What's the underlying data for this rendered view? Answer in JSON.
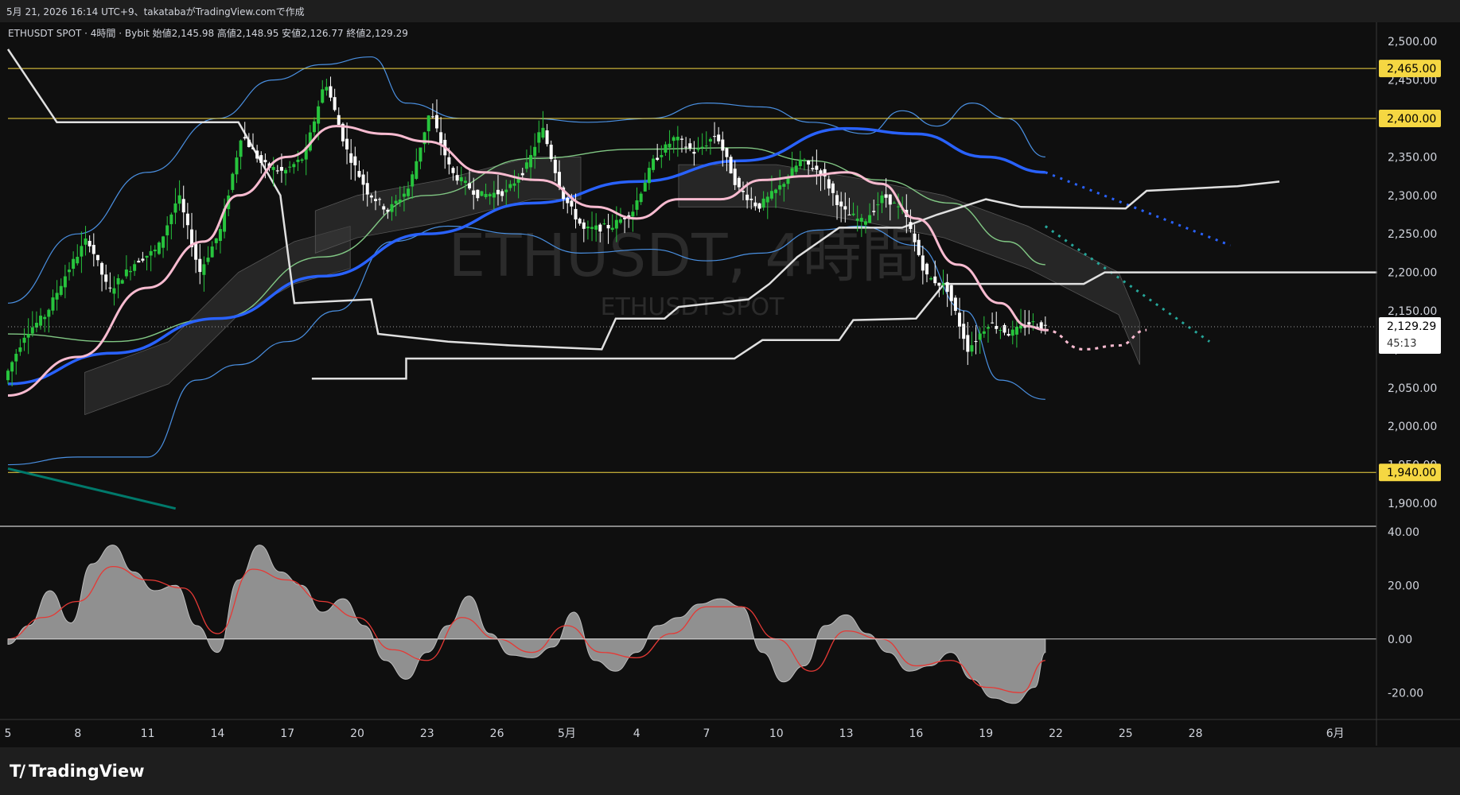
{
  "header": {
    "timestamp_line": "5月 21, 2026 16:14 UTC+9、takatabaがTradingView.comで作成"
  },
  "legend": {
    "text": "ETHUSDT SPOT · 4時間 · Bybit  始値2,145.98 高値2,148.95 安値2,126.77 終値2,129.29"
  },
  "watermark": {
    "main": "ETHUSDT, 4時間",
    "sub": "ETHUSDT SPOT"
  },
  "footer": {
    "brand": "TradingView"
  },
  "colors": {
    "background": "#0f0f0f",
    "candle_up": "#27c43d",
    "candle_down": "#ffffff",
    "pink_ma": "#f8bbd0",
    "blue_ma": "#2962ff",
    "green_ma": "#81c784",
    "bollinger": "#4a90e2",
    "horizontal_level": "#f5d742",
    "oscillator_fill": "#9e9e9e",
    "signal": "#e53935"
  },
  "chart_data": {
    "type": "candlestick",
    "symbol": "ETHUSDT SPOT",
    "interval": "4時間",
    "exchange": "Bybit",
    "ohlc_last": {
      "open": 2145.98,
      "high": 2148.95,
      "low": 2126.77,
      "close": 2129.29
    },
    "last_price": "2,129.29",
    "countdown": "45:13",
    "price_axis": {
      "ylim": [
        1870,
        2525
      ],
      "ticks": [
        1900,
        1950,
        2000,
        2050,
        2100,
        2150,
        2200,
        2250,
        2300,
        2350,
        2400,
        2450,
        2500
      ],
      "tick_labels": [
        "1,900.00",
        "1,950.00",
        "2,000.00",
        "2,050.00",
        "2,100.00",
        "2,150.00",
        "2,200.00",
        "2,250.00",
        "2,300.00",
        "2,350.00",
        "2,400.00",
        "2,450.00",
        "2,500.00"
      ]
    },
    "horizontal_levels": [
      {
        "value": 2465,
        "label": "2,465.00"
      },
      {
        "value": 2400,
        "label": "2,400.00"
      },
      {
        "value": 1940,
        "label": "1,940.00"
      }
    ],
    "x_axis": {
      "ticks": [
        {
          "label": "5",
          "x": 0
        },
        {
          "label": "8",
          "x": 1
        },
        {
          "label": "11",
          "x": 2
        },
        {
          "label": "14",
          "x": 3
        },
        {
          "label": "17",
          "x": 4
        },
        {
          "label": "20",
          "x": 5
        },
        {
          "label": "23",
          "x": 6
        },
        {
          "label": "26",
          "x": 7
        },
        {
          "label": "5月",
          "x": 8
        },
        {
          "label": "4",
          "x": 9
        },
        {
          "label": "7",
          "x": 10
        },
        {
          "label": "10",
          "x": 11
        },
        {
          "label": "13",
          "x": 12
        },
        {
          "label": "16",
          "x": 13
        },
        {
          "label": "19",
          "x": 14
        },
        {
          "label": "22",
          "x": 15
        },
        {
          "label": "25",
          "x": 16
        },
        {
          "label": "28",
          "x": 17
        },
        {
          "label": "6月",
          "x": 19
        }
      ]
    },
    "price_path": [
      [
        0,
        2060
      ],
      [
        0.3,
        2120
      ],
      [
        0.6,
        2145
      ],
      [
        0.9,
        2200
      ],
      [
        1.2,
        2245
      ],
      [
        1.5,
        2175
      ],
      [
        1.9,
        2215
      ],
      [
        2.2,
        2230
      ],
      [
        2.5,
        2300
      ],
      [
        2.8,
        2200
      ],
      [
        3.1,
        2255
      ],
      [
        3.4,
        2380
      ],
      [
        3.7,
        2340
      ],
      [
        4.0,
        2330
      ],
      [
        4.3,
        2350
      ],
      [
        4.6,
        2450
      ],
      [
        4.9,
        2360
      ],
      [
        5.2,
        2305
      ],
      [
        5.5,
        2280
      ],
      [
        5.8,
        2310
      ],
      [
        6.1,
        2410
      ],
      [
        6.4,
        2330
      ],
      [
        6.8,
        2300
      ],
      [
        7.2,
        2305
      ],
      [
        7.5,
        2340
      ],
      [
        7.7,
        2390
      ],
      [
        8.0,
        2300
      ],
      [
        8.3,
        2255
      ],
      [
        8.7,
        2260
      ],
      [
        9.0,
        2280
      ],
      [
        9.3,
        2345
      ],
      [
        9.6,
        2375
      ],
      [
        9.9,
        2355
      ],
      [
        10.2,
        2380
      ],
      [
        10.5,
        2310
      ],
      [
        10.8,
        2285
      ],
      [
        11.1,
        2310
      ],
      [
        11.4,
        2345
      ],
      [
        11.7,
        2330
      ],
      [
        12.0,
        2280
      ],
      [
        12.3,
        2265
      ],
      [
        12.6,
        2300
      ],
      [
        12.9,
        2275
      ],
      [
        13.2,
        2195
      ],
      [
        13.5,
        2180
      ],
      [
        13.8,
        2100
      ],
      [
        14.1,
        2135
      ],
      [
        14.4,
        2120
      ],
      [
        14.7,
        2135
      ],
      [
        14.85,
        2129
      ]
    ],
    "pink_ma": [
      [
        0,
        2040
      ],
      [
        1,
        2090
      ],
      [
        2,
        2180
      ],
      [
        2.8,
        2240
      ],
      [
        3.3,
        2300
      ],
      [
        4,
        2350
      ],
      [
        4.7,
        2390
      ],
      [
        5.4,
        2380
      ],
      [
        6,
        2370
      ],
      [
        6.8,
        2330
      ],
      [
        7.6,
        2320
      ],
      [
        8.4,
        2285
      ],
      [
        9,
        2270
      ],
      [
        9.6,
        2295
      ],
      [
        10.2,
        2295
      ],
      [
        10.8,
        2320
      ],
      [
        11.4,
        2325
      ],
      [
        12,
        2330
      ],
      [
        12.5,
        2315
      ],
      [
        13,
        2270
      ],
      [
        13.6,
        2210
      ],
      [
        14.2,
        2160
      ],
      [
        14.6,
        2130
      ],
      [
        14.85,
        2125
      ]
    ],
    "blue_ma": [
      [
        0,
        2055
      ],
      [
        1.5,
        2095
      ],
      [
        3,
        2140
      ],
      [
        4.5,
        2195
      ],
      [
        6,
        2250
      ],
      [
        7.5,
        2290
      ],
      [
        9,
        2318
      ],
      [
        10.5,
        2345
      ],
      [
        12,
        2387
      ],
      [
        13.0,
        2380
      ],
      [
        14.0,
        2350
      ],
      [
        14.85,
        2330
      ]
    ],
    "blue_ma_projection": [
      [
        14.85,
        2330
      ],
      [
        17.5,
        2235
      ]
    ],
    "green_ma": [
      [
        0,
        2120
      ],
      [
        1.5,
        2110
      ],
      [
        3,
        2140
      ],
      [
        4.5,
        2220
      ],
      [
        6,
        2300
      ],
      [
        7.5,
        2348
      ],
      [
        9,
        2360
      ],
      [
        10.5,
        2362
      ],
      [
        11.5,
        2345
      ],
      [
        12.5,
        2320
      ],
      [
        13.5,
        2290
      ],
      [
        14.3,
        2240
      ],
      [
        14.85,
        2210
      ]
    ],
    "green_projection": [
      [
        14.85,
        2260
      ],
      [
        17.2,
        2110
      ]
    ],
    "bollinger_upper": [
      [
        0,
        2160
      ],
      [
        1,
        2250
      ],
      [
        2,
        2330
      ],
      [
        3,
        2400
      ],
      [
        3.8,
        2450
      ],
      [
        4.5,
        2470
      ],
      [
        5.2,
        2480
      ],
      [
        5.7,
        2420
      ],
      [
        6.5,
        2400
      ],
      [
        7.5,
        2400
      ],
      [
        8.3,
        2395
      ],
      [
        9.2,
        2400
      ],
      [
        10,
        2420
      ],
      [
        10.8,
        2415
      ],
      [
        11.5,
        2395
      ],
      [
        12.3,
        2380
      ],
      [
        12.8,
        2410
      ],
      [
        13.3,
        2390
      ],
      [
        13.8,
        2420
      ],
      [
        14.3,
        2400
      ],
      [
        14.85,
        2350
      ]
    ],
    "bollinger_lower": [
      [
        0,
        1950
      ],
      [
        1,
        1960
      ],
      [
        2,
        1960
      ],
      [
        2.7,
        2060
      ],
      [
        3.3,
        2080
      ],
      [
        4,
        2110
      ],
      [
        4.7,
        2150
      ],
      [
        5.5,
        2240
      ],
      [
        6.3,
        2260
      ],
      [
        7.3,
        2250
      ],
      [
        8.2,
        2225
      ],
      [
        9.2,
        2230
      ],
      [
        10,
        2215
      ],
      [
        10.8,
        2225
      ],
      [
        11.6,
        2255
      ],
      [
        12.2,
        2260
      ],
      [
        13,
        2235
      ],
      [
        13.7,
        2150
      ],
      [
        14.2,
        2060
      ],
      [
        14.85,
        2035
      ]
    ],
    "white_step_line": [
      [
        0,
        2490
      ],
      [
        0.7,
        2395
      ],
      [
        3.3,
        2395
      ],
      [
        3.9,
        2300
      ],
      [
        4.1,
        2160
      ],
      [
        5.2,
        2165
      ],
      [
        5.3,
        2120
      ],
      [
        6.3,
        2110
      ],
      [
        7.2,
        2105
      ],
      [
        8.5,
        2100
      ],
      [
        8.7,
        2140
      ],
      [
        9.4,
        2140
      ],
      [
        9.6,
        2155
      ],
      [
        10.6,
        2165
      ],
      [
        10.9,
        2185
      ],
      [
        11.3,
        2220
      ],
      [
        11.9,
        2258
      ],
      [
        12.8,
        2258
      ],
      [
        13.3,
        2275
      ],
      [
        14.0,
        2295
      ],
      [
        14.5,
        2285
      ],
      [
        16.0,
        2283
      ],
      [
        16.3,
        2306
      ],
      [
        17.6,
        2312
      ],
      [
        18.2,
        2318
      ]
    ],
    "white_lower_line": [
      [
        4.7,
        2062
      ],
      [
        5.7,
        2062
      ],
      [
        5.7,
        2088
      ],
      [
        10.4,
        2088
      ],
      [
        10.8,
        2112
      ],
      [
        11.9,
        2112
      ],
      [
        12.1,
        2138
      ],
      [
        13.0,
        2140
      ],
      [
        13.4,
        2185
      ],
      [
        15.4,
        2185
      ],
      [
        15.7,
        2200
      ],
      [
        19.6,
        2200
      ]
    ],
    "white_lower_line_start": 4.35,
    "projection_dotted": [
      [
        14.85,
        2125
      ],
      [
        15.4,
        2100
      ],
      [
        15.9,
        2105
      ],
      [
        16.3,
        2125
      ]
    ],
    "cloud_segments": [
      [
        [
          1.1,
          2070
        ],
        [
          2.3,
          2110
        ],
        [
          3.3,
          2200
        ],
        [
          4.1,
          2240
        ],
        [
          4.9,
          2260
        ]
      ],
      [
        [
          4.4,
          2280
        ],
        [
          5.0,
          2300
        ],
        [
          6.2,
          2320
        ],
        [
          7.5,
          2350
        ],
        [
          8.2,
          2350
        ]
      ],
      [
        [
          9.6,
          2340
        ],
        [
          11.0,
          2340
        ],
        [
          12.3,
          2320
        ],
        [
          13.4,
          2300
        ],
        [
          14.6,
          2260
        ],
        [
          15.9,
          2200
        ],
        [
          16.2,
          2135
        ]
      ]
    ],
    "trend_line_green": [
      [
        0,
        1945
      ],
      [
        2.4,
        1893
      ]
    ],
    "oscillator": {
      "ylim": [
        -30,
        42
      ],
      "ticks": [
        40,
        20,
        0,
        -20
      ],
      "tick_labels": [
        "40.00",
        "20.00",
        "0.00",
        "-20.00"
      ],
      "values": [
        [
          0,
          -2
        ],
        [
          0.3,
          5
        ],
        [
          0.6,
          18
        ],
        [
          0.9,
          6
        ],
        [
          1.2,
          28
        ],
        [
          1.5,
          35
        ],
        [
          1.8,
          25
        ],
        [
          2.1,
          18
        ],
        [
          2.4,
          20
        ],
        [
          2.7,
          5
        ],
        [
          3.0,
          -5
        ],
        [
          3.3,
          22
        ],
        [
          3.6,
          35
        ],
        [
          3.9,
          25
        ],
        [
          4.2,
          20
        ],
        [
          4.5,
          10
        ],
        [
          4.8,
          15
        ],
        [
          5.1,
          5
        ],
        [
          5.4,
          -8
        ],
        [
          5.7,
          -15
        ],
        [
          6.0,
          -5
        ],
        [
          6.3,
          5
        ],
        [
          6.6,
          16
        ],
        [
          6.9,
          2
        ],
        [
          7.2,
          -6
        ],
        [
          7.5,
          -7
        ],
        [
          7.8,
          -3
        ],
        [
          8.1,
          10
        ],
        [
          8.4,
          -8
        ],
        [
          8.7,
          -12
        ],
        [
          9.0,
          -5
        ],
        [
          9.3,
          5
        ],
        [
          9.6,
          8
        ],
        [
          9.9,
          13
        ],
        [
          10.2,
          15
        ],
        [
          10.5,
          12
        ],
        [
          10.8,
          -5
        ],
        [
          11.1,
          -16
        ],
        [
          11.4,
          -10
        ],
        [
          11.7,
          5
        ],
        [
          12.0,
          9
        ],
        [
          12.3,
          2
        ],
        [
          12.6,
          -5
        ],
        [
          12.9,
          -12
        ],
        [
          13.2,
          -10
        ],
        [
          13.5,
          -5
        ],
        [
          13.8,
          -15
        ],
        [
          14.1,
          -22
        ],
        [
          14.4,
          -24
        ],
        [
          14.7,
          -18
        ],
        [
          14.85,
          -5
        ]
      ],
      "signal": [
        [
          0,
          0
        ],
        [
          0.5,
          8
        ],
        [
          1,
          14
        ],
        [
          1.5,
          27
        ],
        [
          2.0,
          22
        ],
        [
          2.5,
          19
        ],
        [
          3.0,
          2
        ],
        [
          3.5,
          26
        ],
        [
          4.0,
          22
        ],
        [
          4.5,
          14
        ],
        [
          5.0,
          8
        ],
        [
          5.5,
          -4
        ],
        [
          6.0,
          -8
        ],
        [
          6.5,
          8
        ],
        [
          7.0,
          0
        ],
        [
          7.5,
          -5
        ],
        [
          8.0,
          5
        ],
        [
          8.5,
          -5
        ],
        [
          9.0,
          -7
        ],
        [
          9.5,
          2
        ],
        [
          10.0,
          12
        ],
        [
          10.5,
          12
        ],
        [
          11.0,
          0
        ],
        [
          11.5,
          -12
        ],
        [
          12.0,
          3
        ],
        [
          12.5,
          0
        ],
        [
          13.0,
          -10
        ],
        [
          13.5,
          -8
        ],
        [
          14.0,
          -18
        ],
        [
          14.5,
          -20
        ],
        [
          14.85,
          -8
        ]
      ]
    }
  }
}
